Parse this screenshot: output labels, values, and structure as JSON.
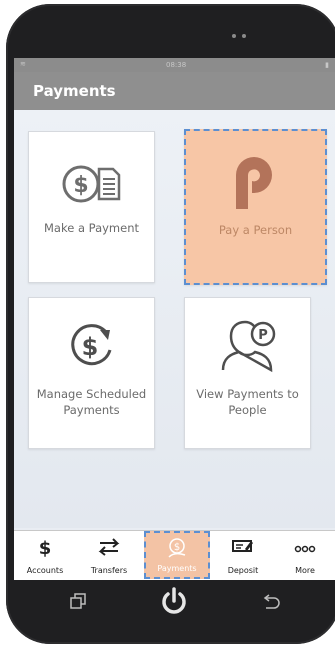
{
  "status_bar": {
    "time": "08:38"
  },
  "header": {
    "title": "Payments"
  },
  "tiles": [
    {
      "label": "Make a Payment",
      "icon": "dollar-document-icon"
    },
    {
      "label": "Pay a Person",
      "icon": "p-logo-icon"
    },
    {
      "label_line1": "Manage Scheduled",
      "label_line2": "Payments",
      "icon": "dollar-refresh-icon"
    },
    {
      "label_line1": "View Payments to",
      "label_line2": "People",
      "icon": "person-p-icon"
    }
  ],
  "tabs": [
    {
      "label": "Accounts",
      "icon": "dollar-icon"
    },
    {
      "label": "Transfers",
      "icon": "transfer-icon"
    },
    {
      "label": "Payments",
      "icon": "payments-icon",
      "active": true
    },
    {
      "label": "Deposit",
      "icon": "check-deposit-icon"
    },
    {
      "label": "More",
      "icon": "more-icon"
    }
  ],
  "colors": {
    "accent": "#f7c6a6",
    "p_logo": "#b3735a",
    "highlight_border": "#5c8fd1"
  }
}
